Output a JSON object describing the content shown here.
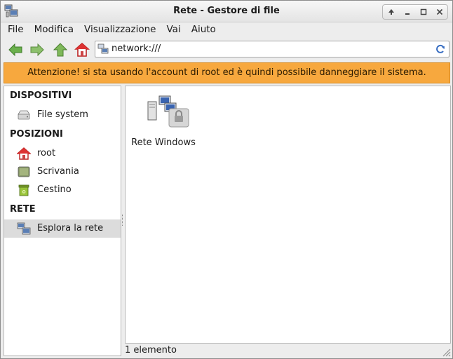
{
  "window": {
    "title": "Rete - Gestore di file"
  },
  "menu": [
    "File",
    "Modifica",
    "Visualizzazione",
    "Vai",
    "Aiuto"
  ],
  "location": {
    "path": "network:///"
  },
  "warning": {
    "text": "Attenzione! si sta usando l'account di root ed è quindi possibile danneggiare il sistema.",
    "color": "#f7a83e"
  },
  "sidebar": {
    "sections": [
      {
        "title": "DISPOSITIVI",
        "items": [
          {
            "label": "File system",
            "icon": "drive-icon"
          }
        ]
      },
      {
        "title": "POSIZIONI",
        "items": [
          {
            "label": "root",
            "icon": "home-icon"
          },
          {
            "label": "Scrivania",
            "icon": "desktop-icon"
          },
          {
            "label": "Cestino",
            "icon": "trash-icon"
          }
        ]
      },
      {
        "title": "RETE",
        "items": [
          {
            "label": "Esplora la rete",
            "icon": "network-icon",
            "selected": true
          }
        ]
      }
    ]
  },
  "files": [
    {
      "label": "Rete Windows",
      "icon": "windows-network-icon"
    }
  ],
  "status": {
    "text": "1 elemento"
  }
}
